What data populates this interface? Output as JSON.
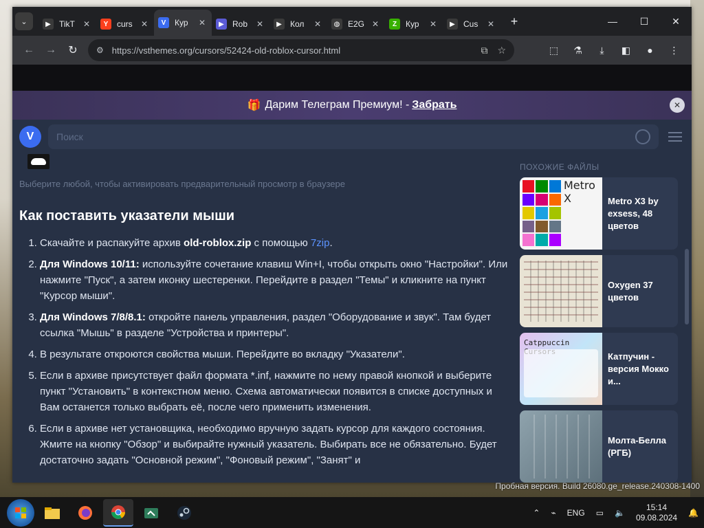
{
  "tabs": [
    {
      "label": "TikT",
      "icon": "tiktok-icon",
      "color": "#3a3a3a"
    },
    {
      "label": "curs",
      "icon": "yandex-icon",
      "color": "#fc3f1d"
    },
    {
      "label": "Кур",
      "icon": "vsthemes-icon",
      "color": "#3b6cf0",
      "active": true
    },
    {
      "label": "Rob",
      "icon": "play-icon",
      "color": "#5b5bd6"
    },
    {
      "label": "Кол",
      "icon": "play-icon",
      "color": "#3a3a3a"
    },
    {
      "label": "E2G",
      "icon": "globe-icon",
      "color": "#3a3a3a"
    },
    {
      "label": "Кур",
      "icon": "z-icon",
      "color": "#38b000"
    },
    {
      "label": "Cus",
      "icon": "play-icon",
      "color": "#3a3a3a"
    }
  ],
  "omnibox": {
    "url": "https://vsthemes.org/cursors/52424-old-roblox-cursor.html"
  },
  "promo": {
    "gift": "🎁",
    "text": "Дарим Телеграм Премиум! - ",
    "link": "Забрать"
  },
  "site": {
    "logo": "V",
    "search_placeholder": "Поиск"
  },
  "content": {
    "hint": "Выберите любой, чтобы активировать предварительный просмотр в браузере",
    "heading": "Как поставить указатели мыши",
    "steps": [
      {
        "pre": "Скачайте и распакуйте архив ",
        "bold": "old-roblox.zip",
        "post": " с помощью ",
        "link": "7zip",
        "tail": "."
      },
      {
        "bold": "Для Windows 10/11:",
        "post": " используйте сочетание клавиш Win+I, чтобы открыть окно \"Настройки\". Или нажмите \"Пуск\", а затем иконку шестеренки. Перейдите в раздел \"Темы\" и кликните на пункт \"Курсор мыши\"."
      },
      {
        "bold": "Для Windows 7/8/8.1:",
        "post": " откройте панель управления, раздел \"Оборудование и звук\". Там будет ссылка \"Мышь\" в разделе \"Устройства и принтеры\"."
      },
      {
        "post": "В результате откроются свойства мыши. Перейдите во вкладку \"Указатели\"."
      },
      {
        "post": "Если в архиве присутствует файл формата *.inf, нажмите по нему правой кнопкой и выберите пункт \"Установить\" в контекстном меню. Схема автоматически появится в списке доступных и Вам останется только выбрать её, после чего применить изменения."
      },
      {
        "post": "Если в архиве нет установщика, необходимо вручную задать курсор для каждого состояния. Жмите на кнопку \"Обзор\" и выбирайте нужный указатель. Выбирать все не обязательно. Будет достаточно задать \"Основной режим\", \"Фоновый режим\", \"Занят\" и"
      }
    ]
  },
  "sidebar": {
    "title": "ПОХОЖИЕ ФАЙЛЫ",
    "cards": [
      {
        "title": "Metro X3 by exsess, 48 цветов",
        "thumb_text": "Metro X"
      },
      {
        "title": "Oxygen 37 цветов",
        "thumb_text": ""
      },
      {
        "title": "Катпучин - версия Мокко и...",
        "thumb_text": "Catppuccin Cursors"
      },
      {
        "title": "Молта-Белла (РГБ)",
        "thumb_text": ""
      }
    ]
  },
  "desktop": {
    "watermark": "Пробная версия. Build 26080.ge_release.240308-1400"
  },
  "taskbar": {
    "lang": "ENG",
    "time": "15:14",
    "date": "09.08.2024"
  }
}
